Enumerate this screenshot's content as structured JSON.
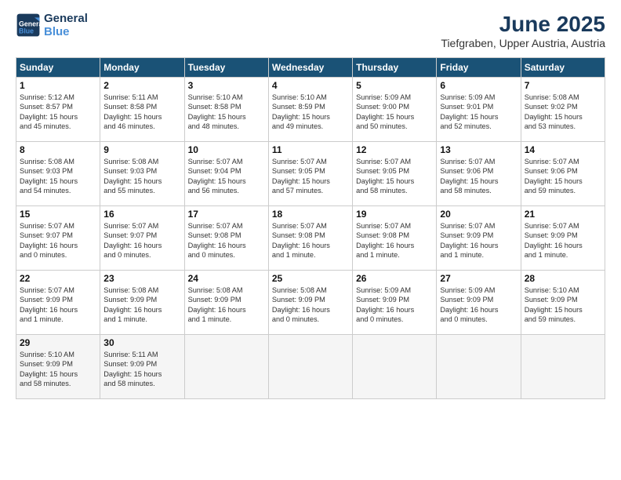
{
  "header": {
    "logo_line1": "General",
    "logo_line2": "Blue",
    "month_year": "June 2025",
    "location": "Tiefgraben, Upper Austria, Austria"
  },
  "weekdays": [
    "Sunday",
    "Monday",
    "Tuesday",
    "Wednesday",
    "Thursday",
    "Friday",
    "Saturday"
  ],
  "weeks": [
    [
      {
        "day": "1",
        "info": "Sunrise: 5:12 AM\nSunset: 8:57 PM\nDaylight: 15 hours\nand 45 minutes."
      },
      {
        "day": "2",
        "info": "Sunrise: 5:11 AM\nSunset: 8:58 PM\nDaylight: 15 hours\nand 46 minutes."
      },
      {
        "day": "3",
        "info": "Sunrise: 5:10 AM\nSunset: 8:58 PM\nDaylight: 15 hours\nand 48 minutes."
      },
      {
        "day": "4",
        "info": "Sunrise: 5:10 AM\nSunset: 8:59 PM\nDaylight: 15 hours\nand 49 minutes."
      },
      {
        "day": "5",
        "info": "Sunrise: 5:09 AM\nSunset: 9:00 PM\nDaylight: 15 hours\nand 50 minutes."
      },
      {
        "day": "6",
        "info": "Sunrise: 5:09 AM\nSunset: 9:01 PM\nDaylight: 15 hours\nand 52 minutes."
      },
      {
        "day": "7",
        "info": "Sunrise: 5:08 AM\nSunset: 9:02 PM\nDaylight: 15 hours\nand 53 minutes."
      }
    ],
    [
      {
        "day": "8",
        "info": "Sunrise: 5:08 AM\nSunset: 9:03 PM\nDaylight: 15 hours\nand 54 minutes."
      },
      {
        "day": "9",
        "info": "Sunrise: 5:08 AM\nSunset: 9:03 PM\nDaylight: 15 hours\nand 55 minutes."
      },
      {
        "day": "10",
        "info": "Sunrise: 5:07 AM\nSunset: 9:04 PM\nDaylight: 15 hours\nand 56 minutes."
      },
      {
        "day": "11",
        "info": "Sunrise: 5:07 AM\nSunset: 9:05 PM\nDaylight: 15 hours\nand 57 minutes."
      },
      {
        "day": "12",
        "info": "Sunrise: 5:07 AM\nSunset: 9:05 PM\nDaylight: 15 hours\nand 58 minutes."
      },
      {
        "day": "13",
        "info": "Sunrise: 5:07 AM\nSunset: 9:06 PM\nDaylight: 15 hours\nand 58 minutes."
      },
      {
        "day": "14",
        "info": "Sunrise: 5:07 AM\nSunset: 9:06 PM\nDaylight: 15 hours\nand 59 minutes."
      }
    ],
    [
      {
        "day": "15",
        "info": "Sunrise: 5:07 AM\nSunset: 9:07 PM\nDaylight: 16 hours\nand 0 minutes."
      },
      {
        "day": "16",
        "info": "Sunrise: 5:07 AM\nSunset: 9:07 PM\nDaylight: 16 hours\nand 0 minutes."
      },
      {
        "day": "17",
        "info": "Sunrise: 5:07 AM\nSunset: 9:08 PM\nDaylight: 16 hours\nand 0 minutes."
      },
      {
        "day": "18",
        "info": "Sunrise: 5:07 AM\nSunset: 9:08 PM\nDaylight: 16 hours\nand 1 minute."
      },
      {
        "day": "19",
        "info": "Sunrise: 5:07 AM\nSunset: 9:08 PM\nDaylight: 16 hours\nand 1 minute."
      },
      {
        "day": "20",
        "info": "Sunrise: 5:07 AM\nSunset: 9:09 PM\nDaylight: 16 hours\nand 1 minute."
      },
      {
        "day": "21",
        "info": "Sunrise: 5:07 AM\nSunset: 9:09 PM\nDaylight: 16 hours\nand 1 minute."
      }
    ],
    [
      {
        "day": "22",
        "info": "Sunrise: 5:07 AM\nSunset: 9:09 PM\nDaylight: 16 hours\nand 1 minute."
      },
      {
        "day": "23",
        "info": "Sunrise: 5:08 AM\nSunset: 9:09 PM\nDaylight: 16 hours\nand 1 minute."
      },
      {
        "day": "24",
        "info": "Sunrise: 5:08 AM\nSunset: 9:09 PM\nDaylight: 16 hours\nand 1 minute."
      },
      {
        "day": "25",
        "info": "Sunrise: 5:08 AM\nSunset: 9:09 PM\nDaylight: 16 hours\nand 0 minutes."
      },
      {
        "day": "26",
        "info": "Sunrise: 5:09 AM\nSunset: 9:09 PM\nDaylight: 16 hours\nand 0 minutes."
      },
      {
        "day": "27",
        "info": "Sunrise: 5:09 AM\nSunset: 9:09 PM\nDaylight: 16 hours\nand 0 minutes."
      },
      {
        "day": "28",
        "info": "Sunrise: 5:10 AM\nSunset: 9:09 PM\nDaylight: 15 hours\nand 59 minutes."
      }
    ],
    [
      {
        "day": "29",
        "info": "Sunrise: 5:10 AM\nSunset: 9:09 PM\nDaylight: 15 hours\nand 58 minutes."
      },
      {
        "day": "30",
        "info": "Sunrise: 5:11 AM\nSunset: 9:09 PM\nDaylight: 15 hours\nand 58 minutes."
      },
      null,
      null,
      null,
      null,
      null
    ]
  ]
}
